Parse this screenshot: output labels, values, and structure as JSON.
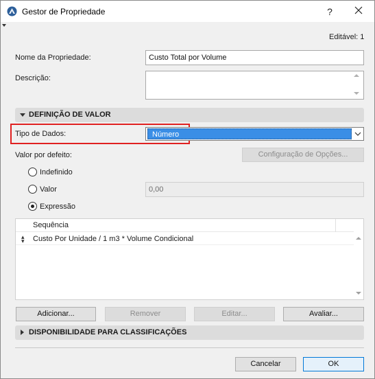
{
  "window": {
    "title": "Gestor de Propriedade",
    "help": "?",
    "close_icon": "close-icon",
    "app_icon": "archicad-logo-icon"
  },
  "editable": "Editável: 1",
  "fields": {
    "name_label": "Nome da Propriedade:",
    "name_value": "Custo Total por Volume",
    "description_label": "Descrição:",
    "description_value": ""
  },
  "value_section": {
    "title": "DEFINIÇÃO DE VALOR",
    "expanded": true,
    "data_type_label": "Tipo de Dados:",
    "data_type_value": "Número",
    "default_label": "Valor por defeito:",
    "options_button": "Configuração de Opções...",
    "radios": [
      {
        "label": "Indefinido",
        "checked": false
      },
      {
        "label": "Valor",
        "checked": false
      },
      {
        "label": "Expressão",
        "checked": true
      }
    ],
    "value_input": "0,00",
    "list": {
      "header": "Sequência",
      "rows": [
        "Custo Por Unidade / 1 m3 * Volume Condicional"
      ]
    },
    "buttons": {
      "add": "Adicionar...",
      "remove": "Remover",
      "edit": "Editar...",
      "evaluate": "Avaliar..."
    }
  },
  "availability_section": {
    "title": "DISPONIBILIDADE PARA CLASSIFICAÇÕES",
    "expanded": false
  },
  "footer": {
    "cancel": "Cancelar",
    "ok": "OK"
  },
  "colors": {
    "selection": "#3a8ee6",
    "highlight": "#e02020",
    "primary_border": "#0078d7"
  }
}
